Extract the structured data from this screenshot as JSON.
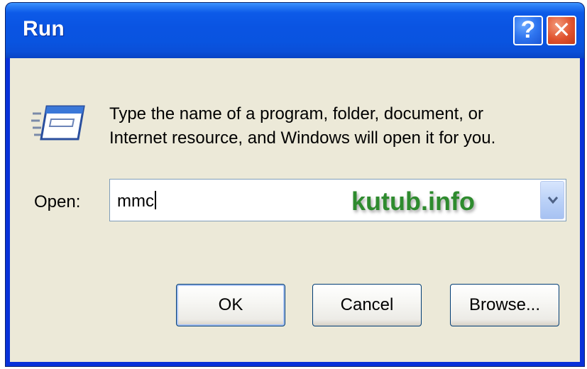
{
  "window": {
    "title": "Run",
    "help_button_label": "?",
    "close_button_label": "✕"
  },
  "dialog": {
    "icon": "run-program-icon",
    "description_line1": "Type the name of a program, folder, document, or",
    "description_line2": "Internet resource, and Windows will open it for you.",
    "open_label": "Open:",
    "open_value": "mmc",
    "watermark": "kutub.info"
  },
  "buttons": {
    "ok_label": "OK",
    "cancel_label": "Cancel",
    "browse_label": "Browse..."
  },
  "colors": {
    "titlebar": "#0a54e2",
    "dialog_background": "#ece9d8",
    "close_button": "#e0532f",
    "watermark": "#2e8b2e"
  }
}
